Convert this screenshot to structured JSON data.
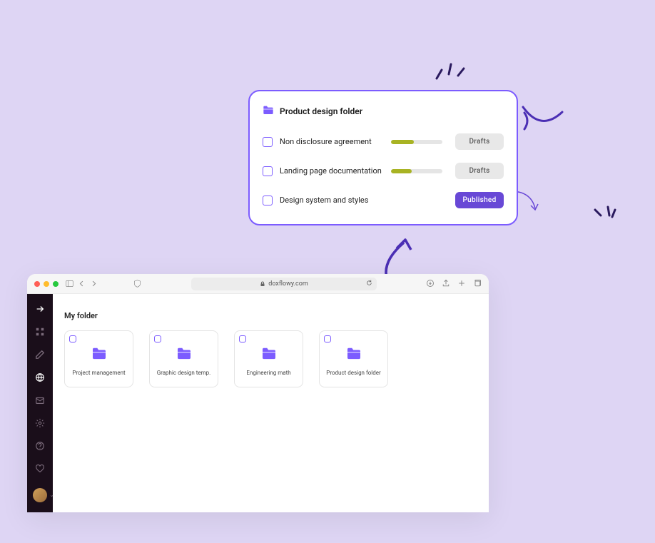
{
  "detail": {
    "title": "Product design folder",
    "docs": [
      {
        "name": "Non disclosure agreement",
        "progress": 45,
        "status": "Drafts",
        "statusClass": "status-draft"
      },
      {
        "name": "Landing page documentation",
        "progress": 40,
        "status": "Drafts",
        "statusClass": "status-draft"
      },
      {
        "name": "Design system and styles",
        "progress": null,
        "status": "Published",
        "statusClass": "status-published"
      }
    ]
  },
  "browser": {
    "url": "doxflowy.com"
  },
  "app": {
    "sectionTitle": "My folder",
    "folders": [
      {
        "label": "Project management"
      },
      {
        "label": "Graphic design temp."
      },
      {
        "label": "Engineering math"
      },
      {
        "label": "Product design folder"
      }
    ]
  }
}
